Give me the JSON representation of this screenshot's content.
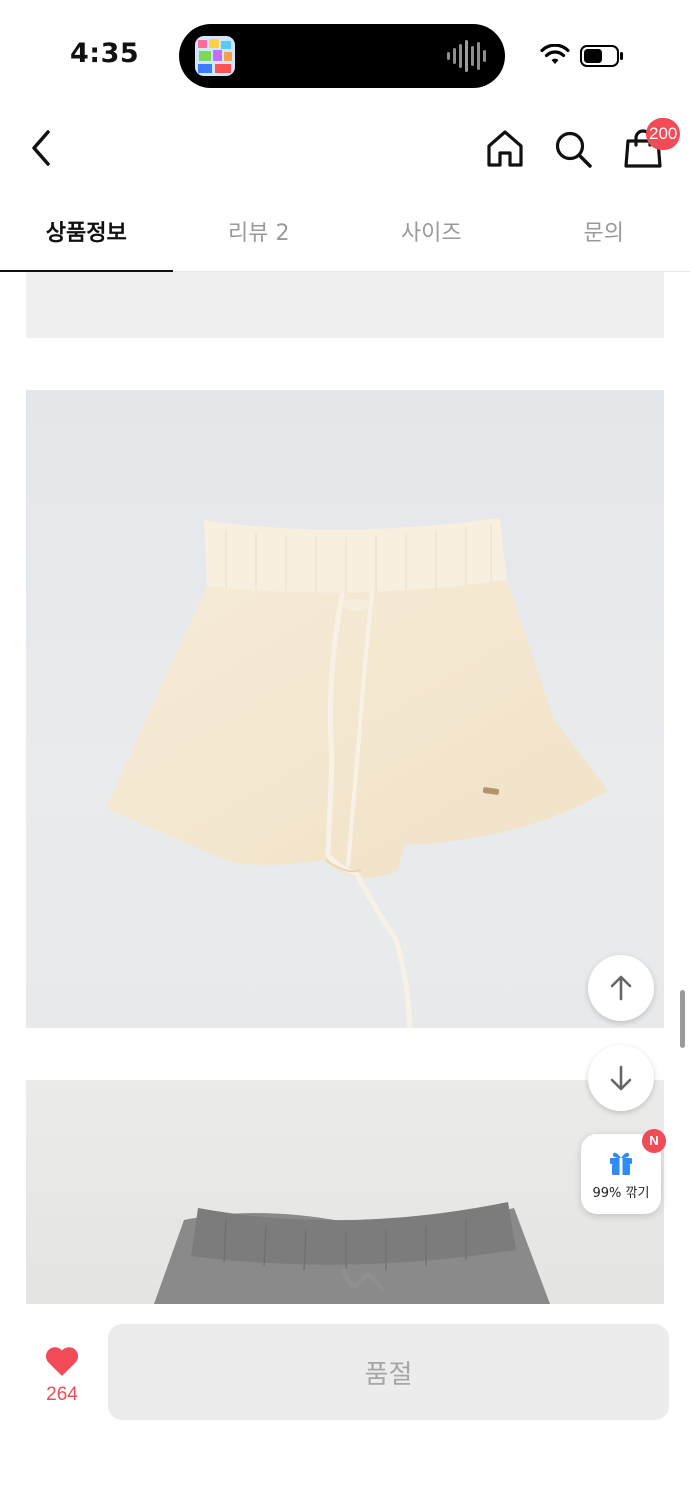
{
  "status_bar": {
    "time": "4:35"
  },
  "header": {
    "cart_count": "200"
  },
  "tabs": [
    {
      "label": "상품정보",
      "active": true
    },
    {
      "label": "리뷰 2",
      "active": false
    },
    {
      "label": "사이즈",
      "active": false
    },
    {
      "label": "문의",
      "active": false
    }
  ],
  "gift": {
    "label": "99% 깎기",
    "badge": "N"
  },
  "bottom": {
    "like_count": "264",
    "soldout_label": "품절"
  },
  "colors": {
    "accent": "#f04b57",
    "gift_blue": "#2f8bf5"
  },
  "icons": [
    "back-arrow-icon",
    "home-icon",
    "search-icon",
    "shopping-bag-icon",
    "arrow-up-icon",
    "arrow-down-icon",
    "gift-icon",
    "heart-icon",
    "wifi-icon",
    "battery-icon"
  ]
}
